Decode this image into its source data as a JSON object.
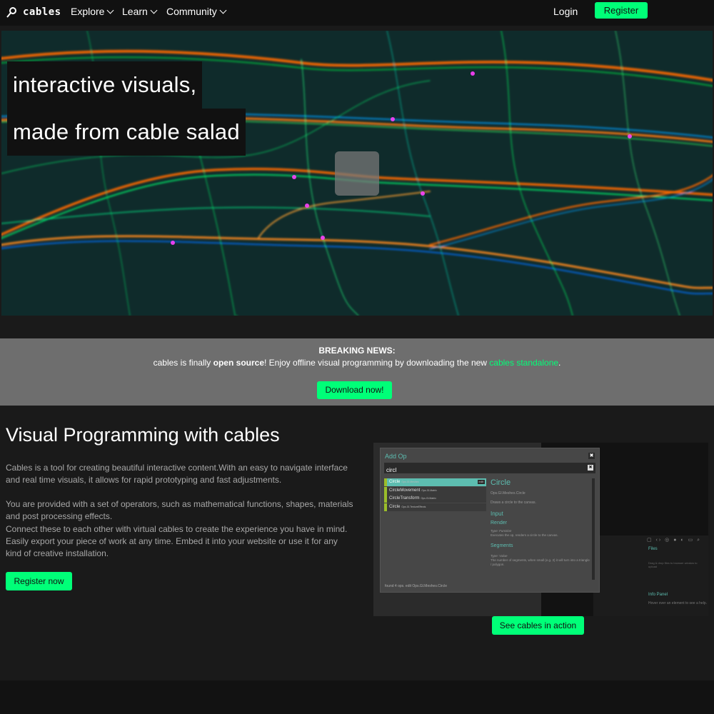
{
  "nav": {
    "logo_text": "cables",
    "explore": "Explore",
    "learn": "Learn",
    "community": "Community",
    "login": "Login",
    "register": "Register",
    "accent": "#00ff78"
  },
  "hero": {
    "line1": "interactive visuals,",
    "line2": "made from cable salad"
  },
  "news": {
    "title": "BREAKING NEWS:",
    "text_pre": "cables is finally ",
    "text_bold": "open source",
    "text_mid": "! Enjoy offline visual programming by downloading the new ",
    "link": "cables standalone",
    "text_post": ".",
    "button": "Download now!"
  },
  "intro": {
    "title": "Visual Programming with cables",
    "para1": "Cables is a tool for creating beautiful interactive content.With an easy to navigate interface and real time visuals, it allows for rapid prototyping and fast adjustments.",
    "para2": "You are provided with a set of operators, such as mathematical functions, shapes, materials and post processing effects.",
    "para3": "Connect these to each other with virtual cables to create the experience you have in mind. Easily export your piece of work at any time. Embed it into your website or use it for any kind of creative installation.",
    "register_now": "Register now",
    "see_action": "See cables in action"
  },
  "editor": {
    "title": "Add Op",
    "search_value": "circl",
    "ops": [
      {
        "name": "Circle",
        "ns": "Ops.Gl.Meshes",
        "edit": "edit"
      },
      {
        "name": "CircleMovement",
        "ns": "Ops.Gl.Matrix",
        "edit": ""
      },
      {
        "name": "CircleTransform",
        "ns": "Ops.Gl.Matrix",
        "edit": ""
      },
      {
        "name": "Circle",
        "ns": "Ops.Gl.TextureEffects",
        "edit": ""
      }
    ],
    "detail_name": "Circle",
    "detail_ns": "Ops.Gl.Meshes.Circle",
    "detail_desc": "Draws a circle to the canvas.",
    "input_heading": "Input",
    "render_heading": "Render",
    "render_type": "Type: Function",
    "render_desc": "Executes the op, renders a circle to the canvas.",
    "segments_heading": "Segments",
    "segments_type": "Type: Value",
    "segments_desc": "The number of segments, when small (e.g. 3) it will turn into a triangle / polygon.",
    "footer": "found 4 ops.  edit Ops.Gl.Meshes.Circle",
    "files": "Files",
    "drag_text": "Drag & drop files to browser window to upload",
    "info_panel": "Info Panel",
    "hover_text": "Hover over an element to see a help."
  }
}
